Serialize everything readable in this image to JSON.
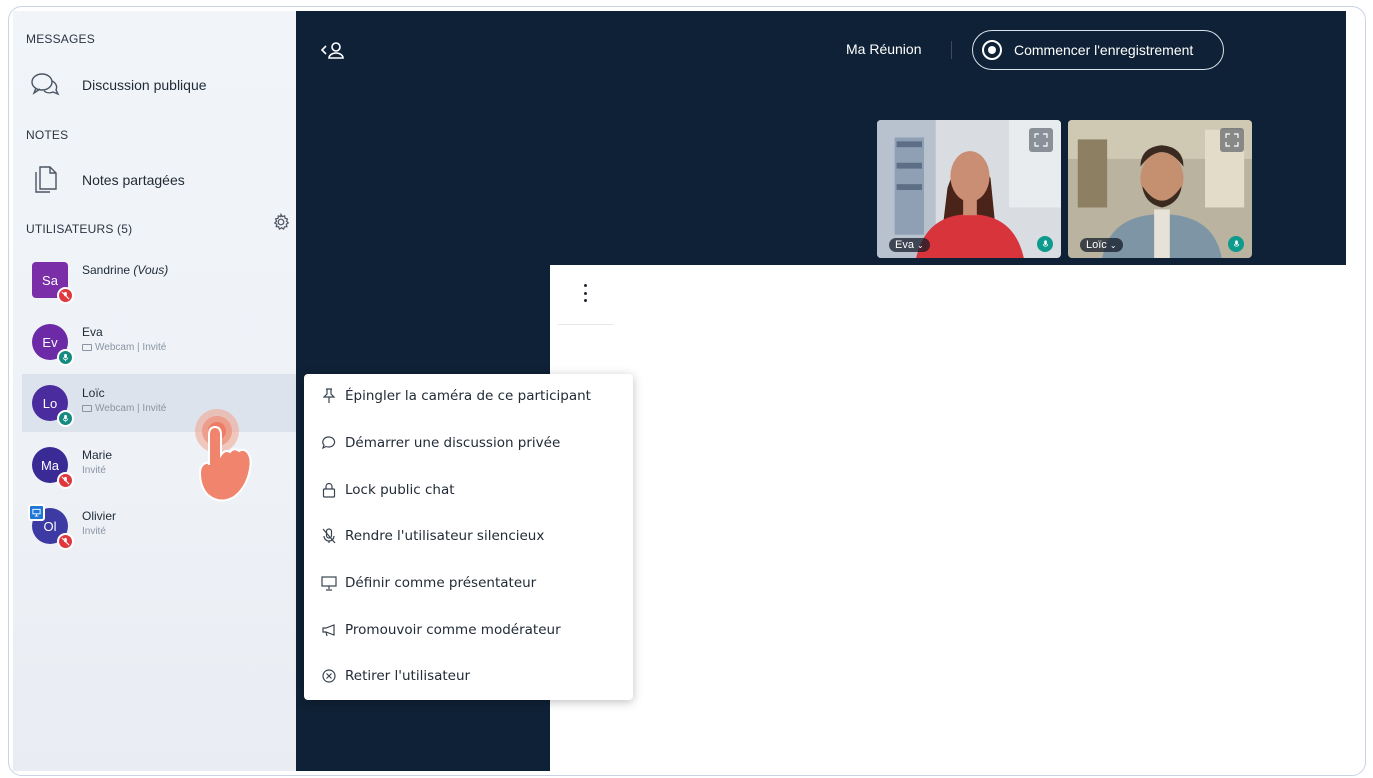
{
  "sidebar": {
    "messages_title": "MESSAGES",
    "public_chat": "Discussion publique",
    "notes_title": "NOTES",
    "shared_notes": "Notes partagées",
    "users_title": "UTILISATEURS (5)",
    "users": [
      {
        "initials": "Sa",
        "name": "Sandrine",
        "you": "(Vous)",
        "sub": "",
        "color": "#7a2ea8",
        "status": "red"
      },
      {
        "initials": "Ev",
        "name": "Eva",
        "sub": "Webcam | Invité",
        "color": "#6c2aa6",
        "status": "teal"
      },
      {
        "initials": "Lo",
        "name": "Loïc",
        "sub": "Webcam | Invité",
        "color": "#4a2c9e",
        "status": "teal"
      },
      {
        "initials": "Ma",
        "name": "Marie",
        "sub": "Invité",
        "color": "#3a2a96",
        "status": "red"
      },
      {
        "initials": "Ol",
        "name": "Olivier",
        "sub": "Invité",
        "color": "#3d3aa4",
        "status": "red"
      }
    ]
  },
  "header": {
    "meeting_name": "Ma Réunion",
    "record_label": "Commencer l'enregistrement"
  },
  "videos": [
    {
      "name": "Eva"
    },
    {
      "name": "Loïc"
    }
  ],
  "context_menu": {
    "items": [
      "Épingler la caméra de ce participant",
      "Démarrer une discussion privée",
      "Lock public chat",
      "Rendre l'utilisateur silencieux",
      "Définir comme présentateur",
      "Promouvoir comme modérateur",
      "Retirer l'utilisateur"
    ]
  },
  "colors": {
    "dark_bg": "#0f2136",
    "mic_on": "#158a80",
    "muted": "#e0373d"
  }
}
